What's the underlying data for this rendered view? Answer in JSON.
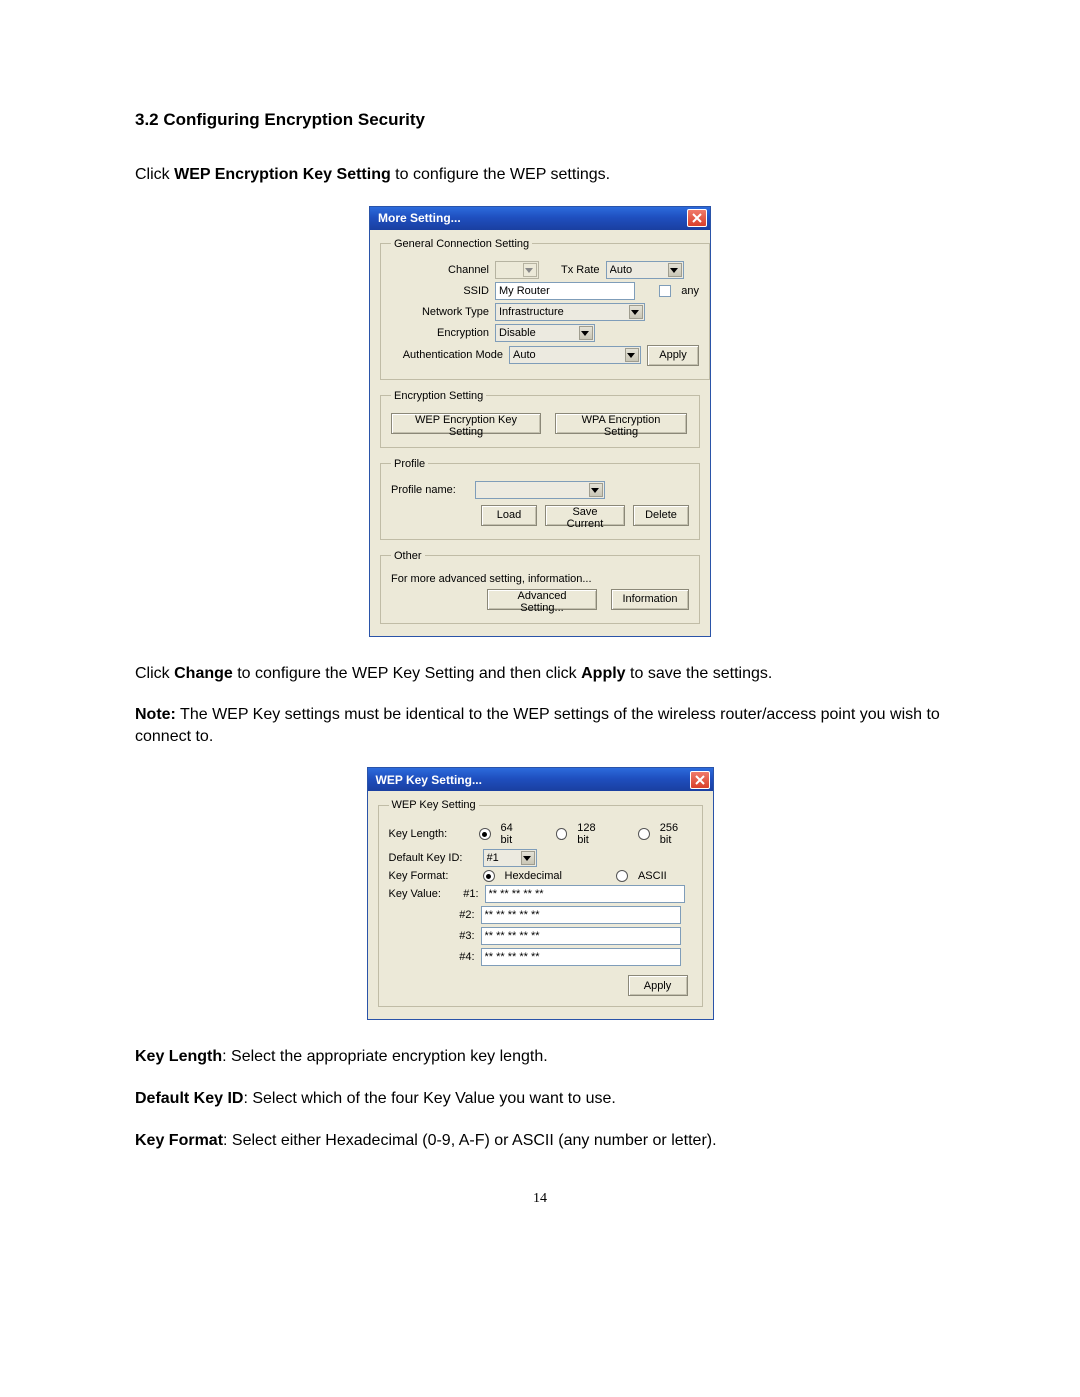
{
  "section_title": "3.2 Configuring Encryption Security",
  "para1_pre": "Click ",
  "para1_bold": "WEP Encryption Key Setting",
  "para1_post": " to configure the WEP settings.",
  "dialog1": {
    "title": "More Setting...",
    "group_general": "General Connection Setting",
    "channel_label": "Channel",
    "channel_value": "",
    "txrate_label": "Tx Rate",
    "txrate_value": "Auto",
    "ssid_label": "SSID",
    "ssid_value": "My Router",
    "any_label": "any",
    "nettype_label": "Network Type",
    "nettype_value": "Infrastructure",
    "enc_label": "Encryption",
    "enc_value": "Disable",
    "auth_label": "Authentication Mode",
    "auth_value": "Auto",
    "apply_label": "Apply",
    "group_enc": "Encryption Setting",
    "wep_btn": "WEP Encryption Key Setting",
    "wpa_btn": "WPA Encryption Setting",
    "group_profile": "Profile",
    "profile_name_label": "Profile name:",
    "load_btn": "Load",
    "savecur_btn": "Save Current",
    "delete_btn": "Delete",
    "group_other": "Other",
    "other_text": "For more advanced setting, information...",
    "adv_btn": "Advanced Setting...",
    "info_btn": "Information"
  },
  "para2_pre": "Click ",
  "para2_b1": "Change",
  "para2_mid": " to configure the WEP Key Setting and then click ",
  "para2_b2": "Apply",
  "para2_post": " to save the settings.",
  "note_b": "Note:",
  "note_text": " The WEP Key settings must be identical to the WEP settings of the wireless router/access point you wish to connect to.",
  "dialog2": {
    "title": "WEP Key Setting...",
    "group": "WEP Key Setting",
    "keylen_label": "Key Length:",
    "r64": "64 bit",
    "r128": "128 bit",
    "r256": "256 bit",
    "defkey_label": "Default Key ID:",
    "defkey_value": "#1",
    "keyfmt_label": "Key Format:",
    "rhex": "Hexdecimal",
    "rascii": "ASCII",
    "keyval_label": "Key Value:",
    "k1l": "#1:",
    "k2l": "#2:",
    "k3l": "#3:",
    "k4l": "#4:",
    "kv": "** ** ** ** **",
    "apply": "Apply"
  },
  "kl_b": "Key Length",
  "kl_t": ": Select the appropriate encryption key length.",
  "dk_b": "Default Key ID",
  "dk_t": ": Select which of the four Key Value you want to use.",
  "kf_b": "Key Format",
  "kf_t": ": Select either Hexadecimal (0-9, A-F) or ASCII (any number or letter).",
  "page_no": "14"
}
